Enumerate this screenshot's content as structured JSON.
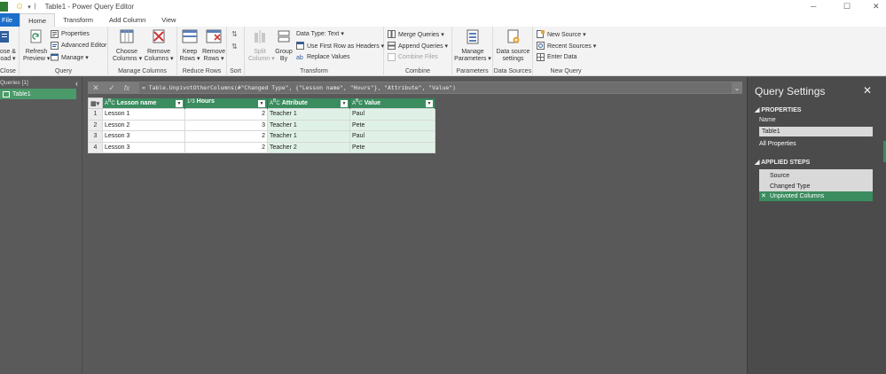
{
  "window": {
    "title": "Table1 - Power Query Editor"
  },
  "tabs": [
    {
      "label": "File"
    },
    {
      "label": "Home"
    },
    {
      "label": "Transform"
    },
    {
      "label": "Add Column"
    },
    {
      "label": "View"
    }
  ],
  "ribbon": {
    "close_group": {
      "label1": "ose &",
      "label2": "oad ▾",
      "group": "Close"
    },
    "query_group": {
      "refresh1": "Refresh",
      "refresh2": "Preview ▾",
      "properties": "Properties",
      "advanced_editor": "Advanced Editor",
      "manage": "Manage ▾",
      "group": "Query"
    },
    "manage_columns_group": {
      "choose1": "Choose",
      "choose2": "Columns ▾",
      "remove1": "Remove",
      "remove2": "Columns ▾",
      "group": "Manage Columns"
    },
    "reduce_rows_group": {
      "keep1": "Keep",
      "keep2": "Rows ▾",
      "remove1": "Remove",
      "remove2": "Rows ▾",
      "group": "Reduce Rows"
    },
    "sort_group": {
      "group": "Sort"
    },
    "transform_group": {
      "split1": "Split",
      "split2": "Column ▾",
      "group1": "Group",
      "group2": "By",
      "data_type": "Data Type: Text ▾",
      "first_row": "Use First Row as Headers ▾",
      "replace": "Replace Values",
      "group": "Transform"
    },
    "combine_group": {
      "merge": "Merge Queries ▾",
      "append": "Append Queries ▾",
      "combine_files": "Combine Files",
      "group": "Combine"
    },
    "parameters_group": {
      "manage1": "Manage",
      "manage2": "Parameters ▾",
      "group": "Parameters"
    },
    "data_sources_group": {
      "ds1": "Data source",
      "ds2": "settings",
      "group": "Data Sources"
    },
    "new_query_group": {
      "new_source": "New Source ▾",
      "recent": "Recent Sources ▾",
      "enter": "Enter Data",
      "group": "New Query"
    }
  },
  "queries_pane": {
    "header": "Queries [1]",
    "items": [
      {
        "label": "Table1"
      }
    ]
  },
  "formula_bar": {
    "formula": "= Table.UnpivotOtherColumns(#\"Changed Type\", {\"Lesson name\", \"Hours\"}, \"Attribute\", \"Value\")"
  },
  "grid": {
    "columns": [
      {
        "name": "Lesson name",
        "type_icon": "ABC"
      },
      {
        "name": "Hours",
        "type_icon": "123"
      },
      {
        "name": "Attribute",
        "type_icon": "ABC"
      },
      {
        "name": "Value",
        "type_icon": "ABC"
      }
    ],
    "rows": [
      {
        "n": "1",
        "lesson": "Lesson 1",
        "hours": "2",
        "attribute": "Teacher 1",
        "value": "Paul"
      },
      {
        "n": "2",
        "lesson": "Lesson 2",
        "hours": "3",
        "attribute": "Teacher 1",
        "value": "Pete"
      },
      {
        "n": "3",
        "lesson": "Lesson 3",
        "hours": "2",
        "attribute": "Teacher 1",
        "value": "Paul"
      },
      {
        "n": "4",
        "lesson": "Lesson 3",
        "hours": "2",
        "attribute": "Teacher 2",
        "value": "Pete"
      }
    ]
  },
  "query_settings": {
    "title": "Query Settings",
    "properties_header": "PROPERTIES",
    "name_label": "Name",
    "name_value": "Table1",
    "all_properties": "All Properties",
    "applied_steps_header": "APPLIED STEPS",
    "steps": [
      {
        "label": "Source"
      },
      {
        "label": "Changed Type"
      },
      {
        "label": "Unpivoted Columns"
      }
    ]
  },
  "colors": {
    "accent": "#3b8c5f",
    "file_tab": "#1e6fc9"
  }
}
